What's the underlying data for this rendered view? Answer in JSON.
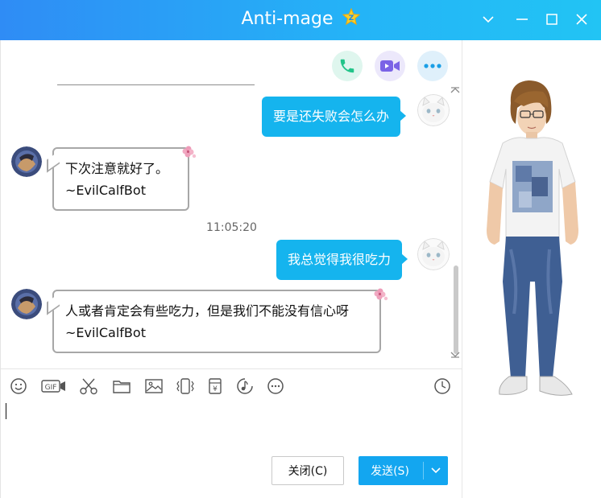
{
  "window": {
    "title": "Anti-mage",
    "controls": [
      "chevron-down-icon",
      "minimize-icon",
      "maximize-icon",
      "close-icon"
    ]
  },
  "actions": [
    "phone-call-icon",
    "video-call-icon",
    "more-icon"
  ],
  "messages": [
    {
      "direction": "out",
      "text": "要是还失败会怎么办"
    },
    {
      "direction": "in",
      "lines": [
        "下次注意就好了。",
        "~EvilCalfBot"
      ]
    },
    {
      "direction": "time",
      "text": "11:05:20"
    },
    {
      "direction": "out",
      "text": "我总觉得我很吃力"
    },
    {
      "direction": "in",
      "lines": [
        "人或者肯定会有些吃力，但是我们不能没有信心呀",
        "~EvilCalfBot"
      ]
    }
  ],
  "toolbar": [
    "emoji-icon",
    "gif-icon",
    "scissors-icon",
    "folder-icon",
    "image-icon",
    "shake-icon",
    "red-packet-icon",
    "music-icon",
    "more-icon",
    "history-clock-icon"
  ],
  "input": {
    "value": ""
  },
  "buttons": {
    "close_label": "关闭(C)",
    "send_label": "发送(S)"
  },
  "colors": {
    "titlebar_start": "#2f8cf5",
    "titlebar_end": "#22c4f4",
    "bubble_out": "#15b4ee",
    "send_button": "#13a6f0"
  }
}
